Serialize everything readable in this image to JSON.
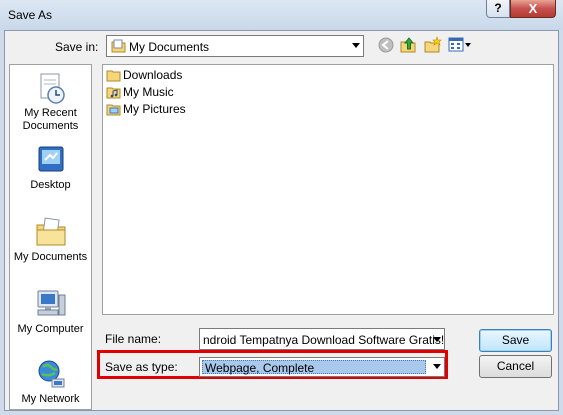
{
  "window": {
    "title": "Save As",
    "help_label": "?",
    "close_label": "X"
  },
  "toolbar": {
    "save_in_label": "Save in:",
    "save_in_value": "My Documents",
    "buttons": [
      "back-icon",
      "up-folder-icon",
      "new-folder-icon",
      "views-icon"
    ]
  },
  "places": [
    {
      "label": "My Recent Documents",
      "icon": "recent-documents-icon"
    },
    {
      "label": "Desktop",
      "icon": "desktop-icon"
    },
    {
      "label": "My Documents",
      "icon": "my-documents-icon"
    },
    {
      "label": "My Computer",
      "icon": "my-computer-icon"
    },
    {
      "label": "My Network",
      "icon": "my-network-icon"
    }
  ],
  "files": [
    {
      "name": "Downloads",
      "icon": "folder-icon"
    },
    {
      "name": "My Music",
      "icon": "music-folder-icon"
    },
    {
      "name": "My Pictures",
      "icon": "pictures-folder-icon"
    }
  ],
  "form": {
    "file_name_label": "File name:",
    "file_name_value": "ndroid   Tempatnya Download Software Gratis!",
    "save_as_type_label": "Save as type:",
    "save_as_type_value": "Webpage, Complete"
  },
  "actions": {
    "save_label": "Save",
    "cancel_label": "Cancel"
  },
  "colors": {
    "highlight": "#e00000",
    "selection": "#a8c8ec",
    "title_bar": "#cfdbea"
  }
}
